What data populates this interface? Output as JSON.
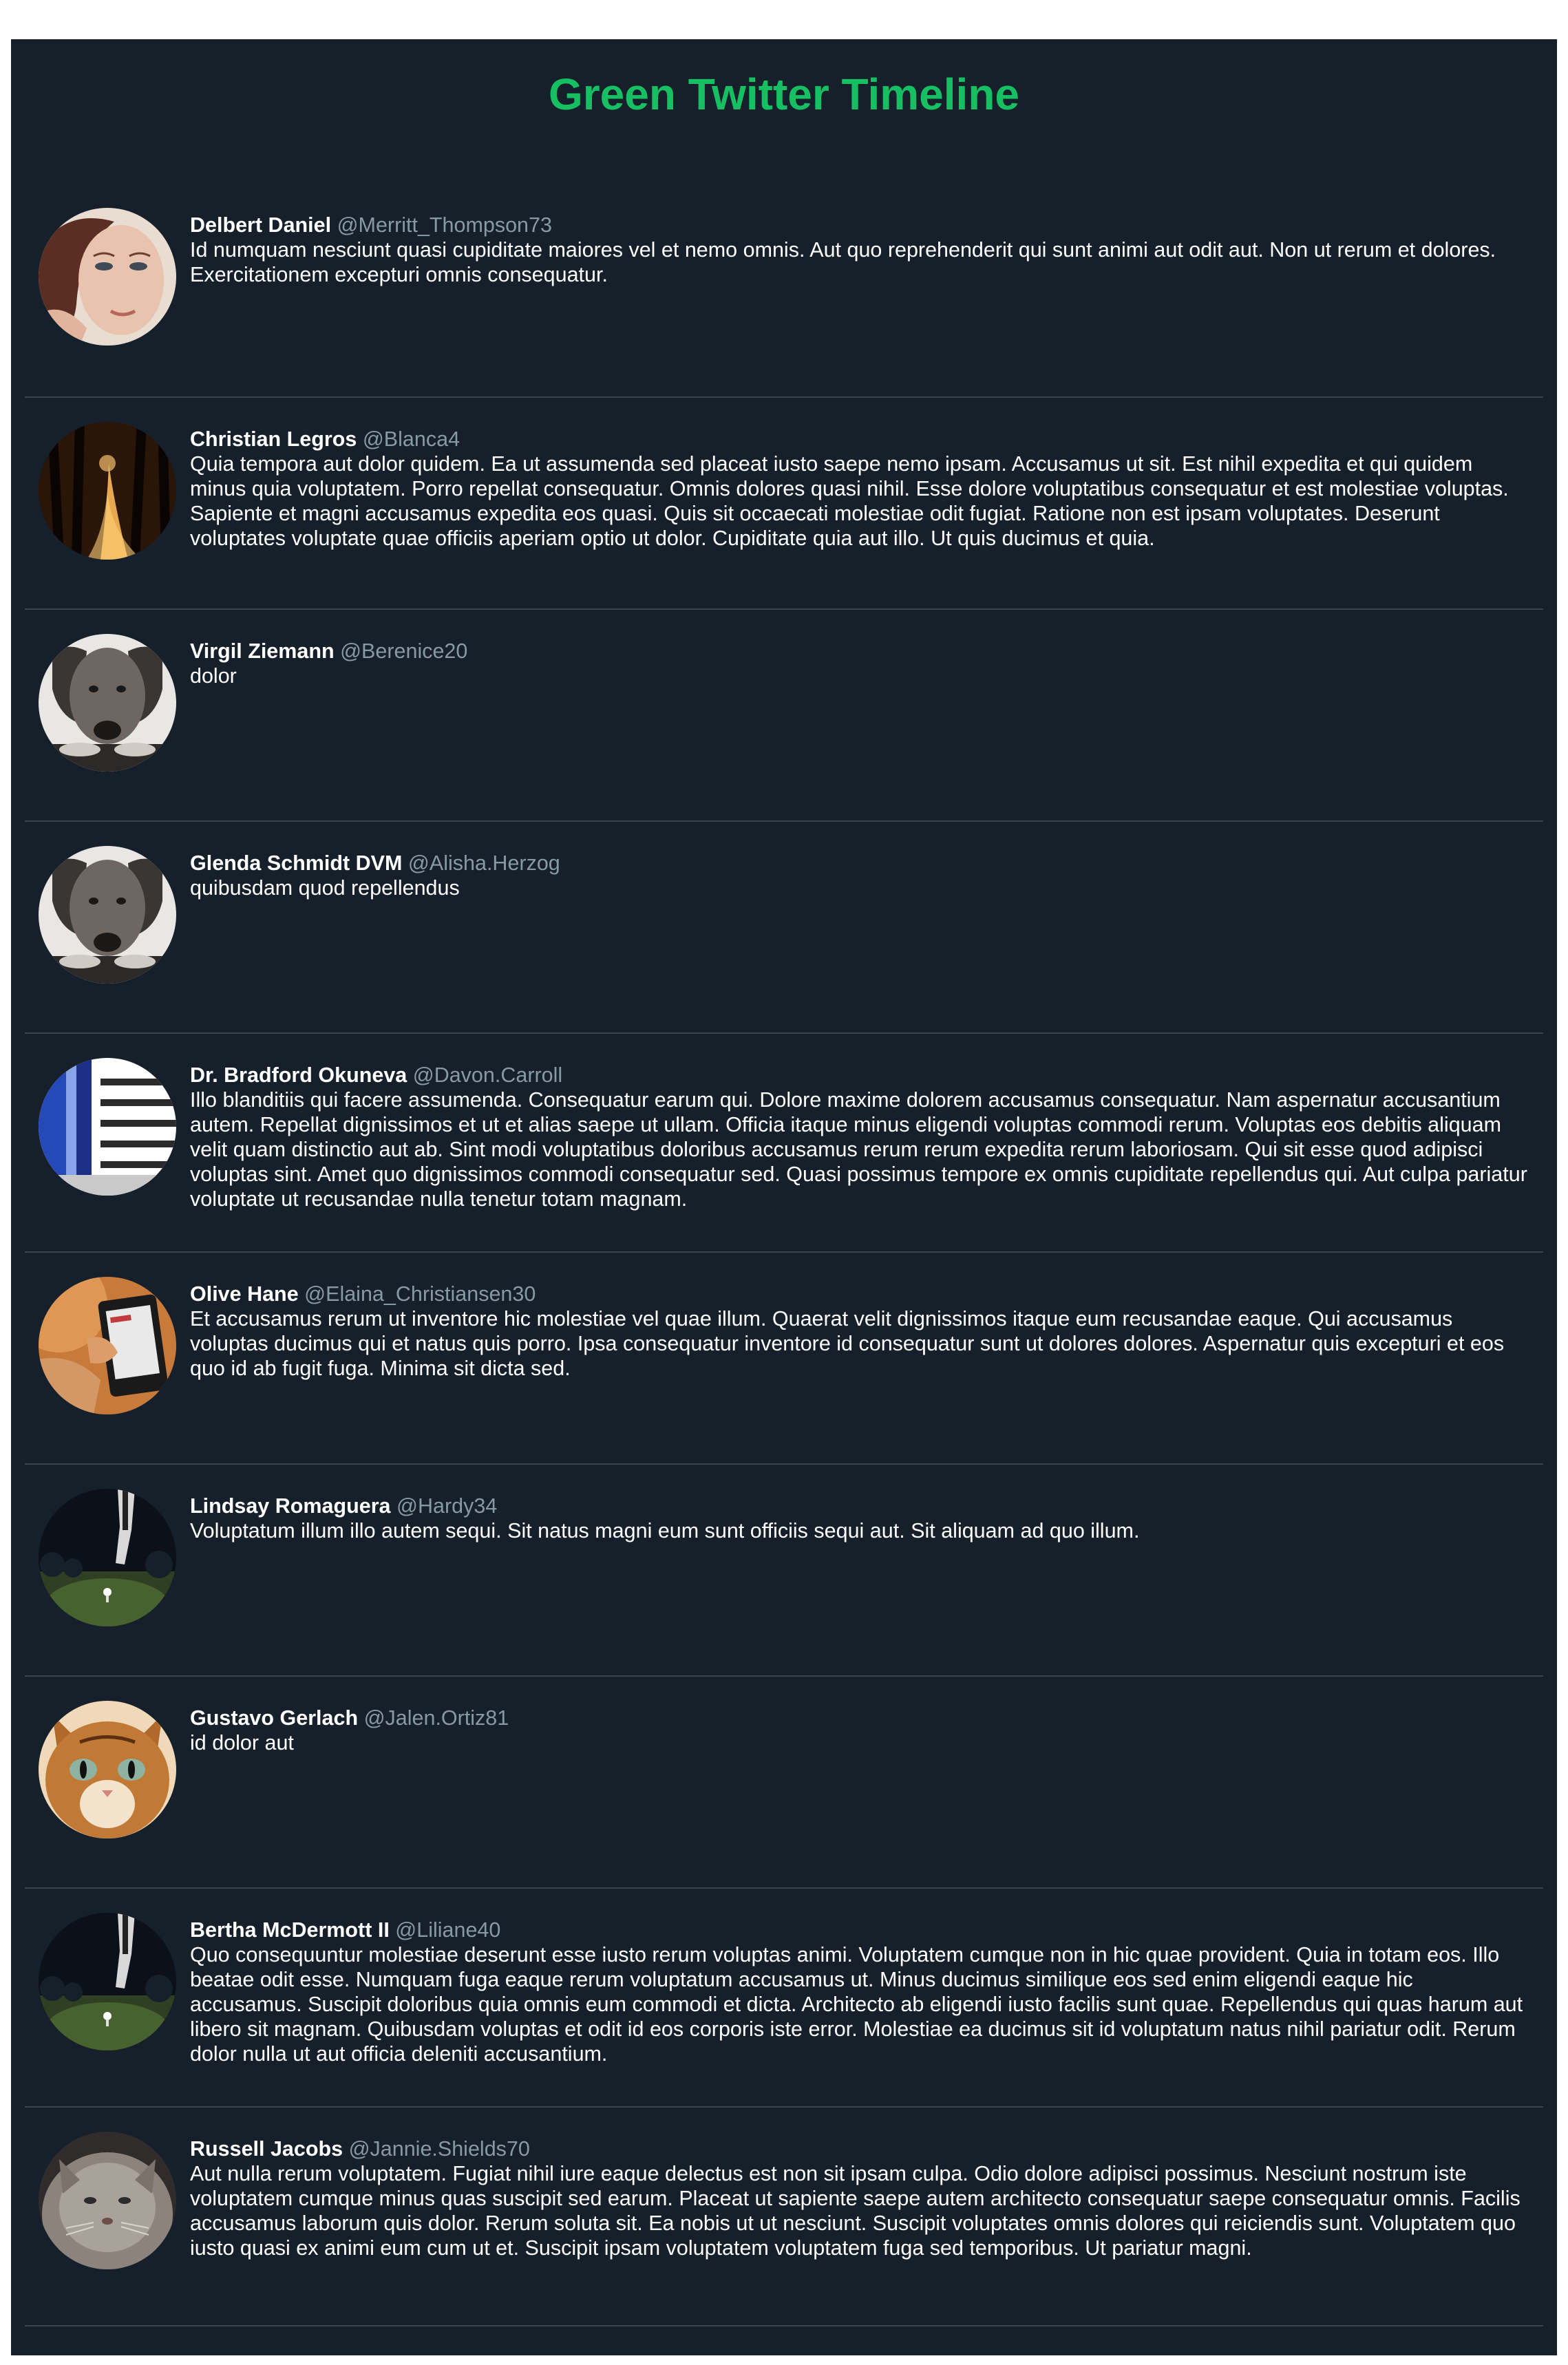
{
  "page": {
    "title": "Green Twitter Timeline"
  },
  "colors": {
    "page_background": "#ffffff",
    "panel_background": "#15202b",
    "title_color": "#17bf63",
    "handle_color": "#8899a6",
    "divider_color": "#38444d",
    "text_color": "#ffffff"
  },
  "tweets": [
    {
      "name": "Delbert Daniel",
      "handle": "@Merritt_Thompson73",
      "avatar": "woman-portrait",
      "text": "Id numquam nesciunt quasi cupiditate maiores vel et nemo omnis. Aut quo reprehenderit qui sunt animi aut odit aut. Non ut rerum et dolores. Exercitationem excepturi omnis consequatur."
    },
    {
      "name": "Christian Legros",
      "handle": "@Blanca4",
      "avatar": "autumn-forest-path",
      "text": "Quia tempora aut dolor quidem. Ea ut assumenda sed placeat iusto saepe nemo ipsam. Accusamus ut sit. Est nihil expedita et qui quidem minus quia voluptatem. Porro repellat consequatur. Omnis dolores quasi nihil. Esse dolore voluptatibus consequatur et est molestiae voluptas. Sapiente et magni accusamus expedita eos quasi. Quis sit occaecati molestiae odit fugiat. Ratione non est ipsam voluptates. Deserunt voluptates voluptate quae officiis aperiam optio ut dolor. Cupiditate quia aut illo. Ut quis ducimus et quia."
    },
    {
      "name": "Virgil Ziemann",
      "handle": "@Berenice20",
      "avatar": "dog-bw",
      "text": "dolor"
    },
    {
      "name": "Glenda Schmidt DVM",
      "handle": "@Alisha.Herzog",
      "avatar": "dog-bw",
      "text": "quibusdam quod repellendus"
    },
    {
      "name": "Dr. Bradford Okuneva",
      "handle": "@Davon.Carroll",
      "avatar": "building-facade",
      "text": "Illo blanditiis qui facere assumenda. Consequatur earum qui. Dolore maxime dolorem accusamus consequatur. Nam aspernatur accusantium autem. Repellat dignissimos et ut et alias saepe ut ullam. Officia itaque minus eligendi voluptas commodi rerum. Voluptas eos debitis aliquam velit quam distinctio aut ab. Sint modi voluptatibus doloribus accusamus rerum rerum expedita rerum laboriosam. Qui sit esse quod adipisci voluptas sint. Amet quo dignissimos commodi consequatur sed. Quasi possimus tempore ex omnis cupiditate repellendus qui. Aut culpa pariatur voluptate ut recusandae nulla tenetur totam magnam."
    },
    {
      "name": "Olive Hane",
      "handle": "@Elaina_Christiansen30",
      "avatar": "hand-tablet",
      "text": "Et accusamus rerum ut inventore hic molestiae vel quae illum. Quaerat velit dignissimos itaque eum recusandae eaque. Qui accusamus voluptas ducimus qui et natus quis porro. Ipsa consequatur inventore id consequatur sunt ut dolores dolores. Aspernatur quis excepturi et eos quo id ab fugit fuga. Minima sit dicta sed."
    },
    {
      "name": "Lindsay Romaguera",
      "handle": "@Hardy34",
      "avatar": "golf-night",
      "text": "Voluptatum illum illo autem sequi. Sit natus magni eum sunt officiis sequi aut. Sit aliquam ad quo illum."
    },
    {
      "name": "Gustavo Gerlach",
      "handle": "@Jalen.Ortiz81",
      "avatar": "cat-face",
      "text": "id dolor aut"
    },
    {
      "name": "Bertha McDermott II",
      "handle": "@Liliane40",
      "avatar": "golf-night",
      "text": "Quo consequuntur molestiae deserunt esse iusto rerum voluptas animi. Voluptatem cumque non in hic quae provident. Quia in totam eos. Illo beatae odit esse. Numquam fuga eaque rerum voluptatum accusamus ut. Minus ducimus similique eos sed enim eligendi eaque hic accusamus. Suscipit doloribus quia omnis eum commodi et dicta. Architecto ab eligendi iusto facilis sunt quae. Repellendus qui quas harum aut libero sit magnam. Quibusdam voluptas et odit id eos corporis iste error. Molestiae ea ducimus sit id voluptatum natus nihil pariatur odit. Rerum dolor nulla ut aut officia deleniti accusantium."
    },
    {
      "name": "Russell Jacobs",
      "handle": "@Jannie.Shields70",
      "avatar": "fluffy-cat",
      "text": "Aut nulla rerum voluptatem. Fugiat nihil iure eaque delectus est non sit ipsam culpa. Odio dolore adipisci possimus. Nesciunt nostrum iste voluptatem cumque minus quas suscipit sed earum. Placeat ut sapiente saepe autem architecto consequatur saepe consequatur omnis. Facilis accusamus laborum quis dolor. Rerum soluta sit. Ea nobis ut ut nesciunt. Suscipit voluptates omnis dolores qui reiciendis sunt. Voluptatem quo iusto quasi ex animi eum cum ut et. Suscipit ipsam voluptatem voluptatem fuga sed temporibus. Ut pariatur magni."
    }
  ]
}
